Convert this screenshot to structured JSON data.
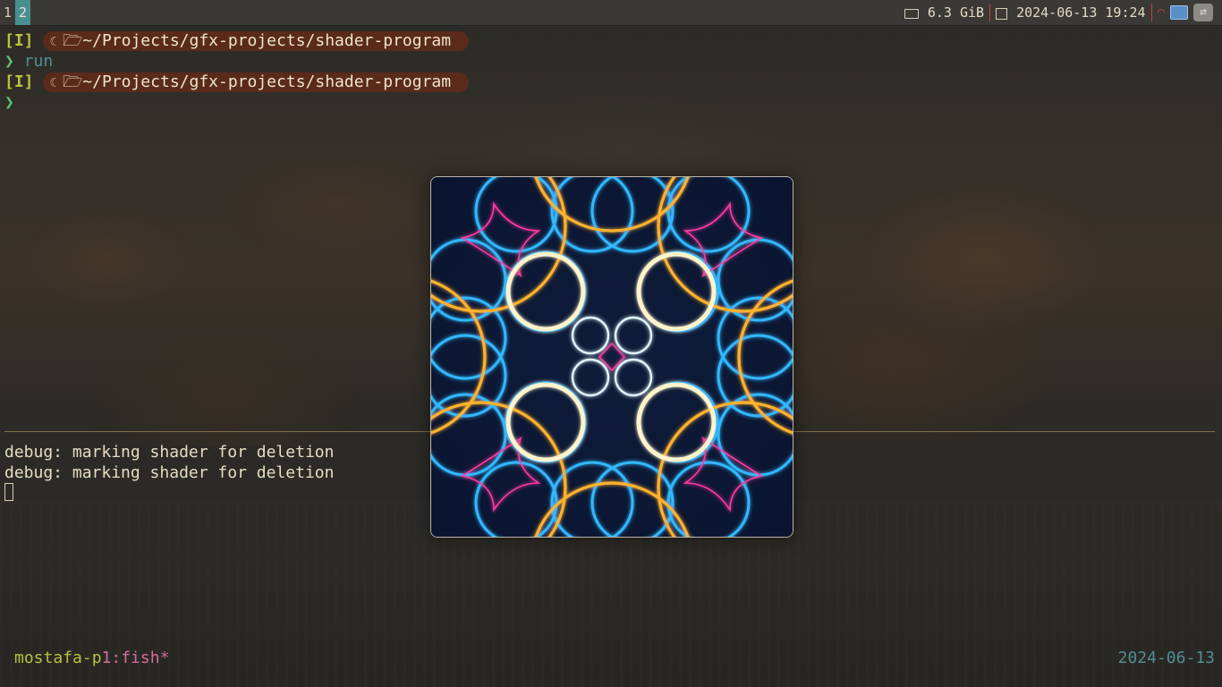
{
  "topbar": {
    "workspaces": [
      {
        "label": "1",
        "active": false
      },
      {
        "label": "2",
        "active": true
      }
    ],
    "memory": "6.3 GiB",
    "datetime": "2024-06-13 19:24",
    "icons": [
      "memory-icon",
      "calendar-icon",
      "wifi-icon",
      "network-icon",
      "swap-icon"
    ]
  },
  "terminal": {
    "prompt1": {
      "mode": "[I]",
      "path": "~/Projects/gfx-projects/shader-program"
    },
    "command1": {
      "chevron": "❯",
      "text": "run"
    },
    "prompt2": {
      "mode": "[I]",
      "path": "~/Projects/gfx-projects/shader-program"
    },
    "command2": {
      "chevron": "❯",
      "text": ""
    },
    "output": [
      "debug: marking shader for deletion",
      "debug: marking shader for deletion"
    ]
  },
  "statusline": {
    "host": "mostafa-p",
    "session": "1:fish*",
    "date": "2024-06-13"
  },
  "colors": {
    "accent_ws": "#4a8f8f",
    "mode": "#b8c43a",
    "path_bg": "#5a2a1a",
    "chevron": "#59c27a",
    "cmd": "#4f8f93",
    "host": "#b5c33d",
    "session": "#d16d9e"
  },
  "shader_window": {
    "icon": "shader-render-window"
  }
}
